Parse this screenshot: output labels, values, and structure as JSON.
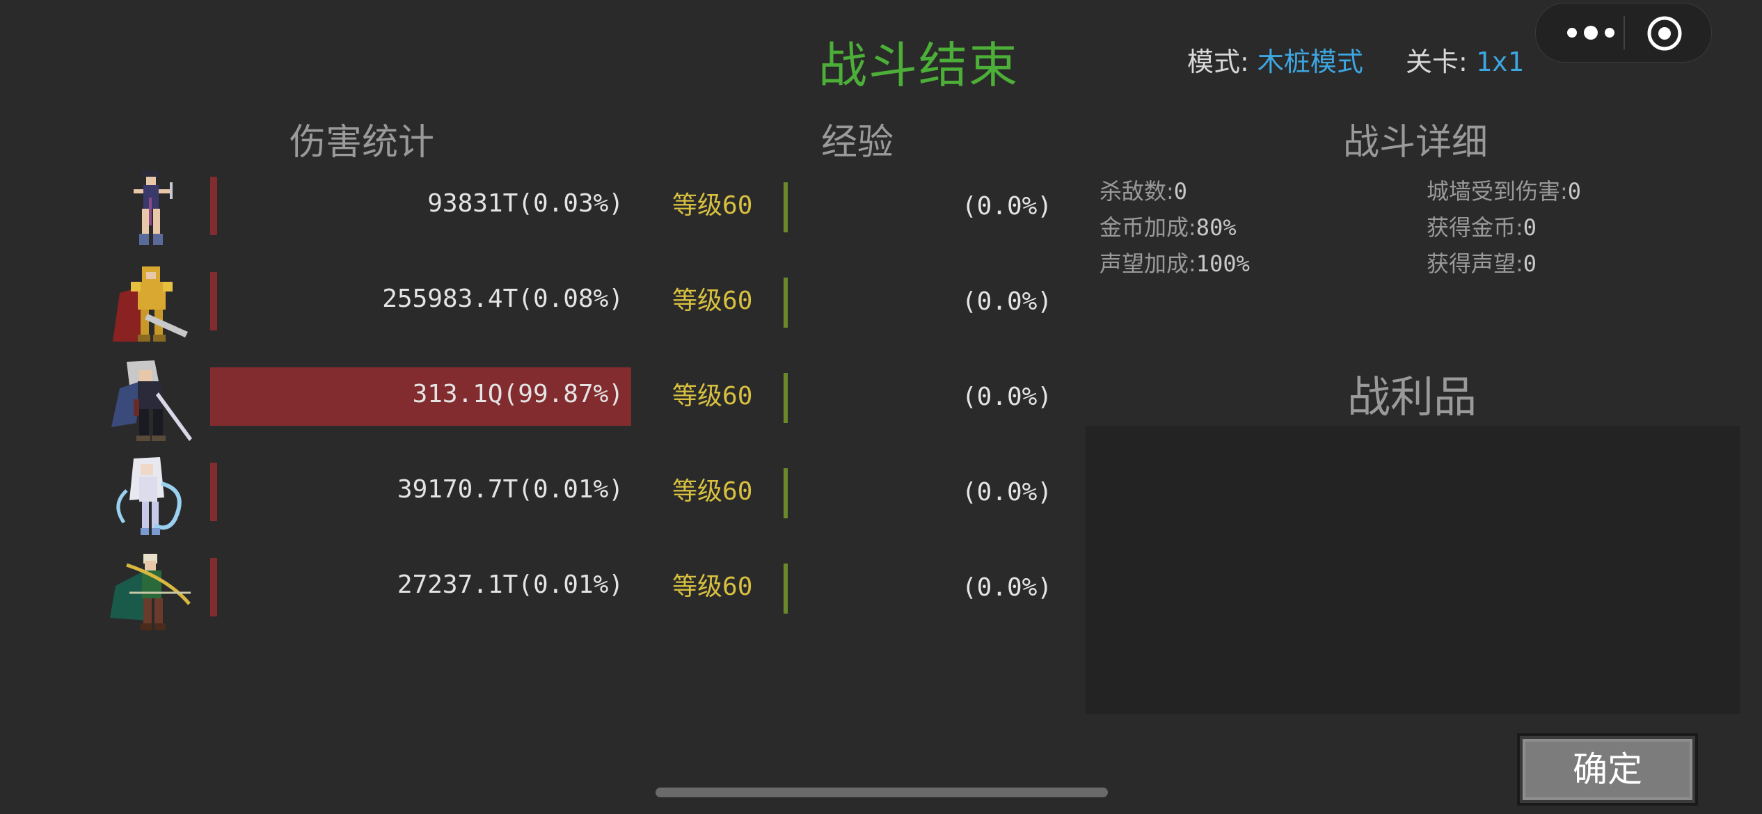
{
  "header": {
    "title": "战斗结束",
    "mode_label": "模式:",
    "mode_value": "木桩模式",
    "stage_label": "关卡:",
    "stage_value": "1x1"
  },
  "system_pill": {
    "more_icon": "more-dots-icon",
    "close_icon": "target-circle-icon"
  },
  "sections": {
    "damage": "伤害统计",
    "exp": "经验",
    "details": "战斗详细",
    "loot": "战利品"
  },
  "heroes": [
    {
      "avatar": "hero-assassin",
      "damage_text": "93831T(0.03%)",
      "damage_fraction": 0.0003,
      "level_label": "等级",
      "level_num": "60",
      "exp_text": "(0.0%)",
      "exp_fraction": 0.0
    },
    {
      "avatar": "hero-knight",
      "damage_text": "255983.4T(0.08%)",
      "damage_fraction": 0.0008,
      "level_label": "等级",
      "level_num": "60",
      "exp_text": "(0.0%)",
      "exp_fraction": 0.0
    },
    {
      "avatar": "hero-swordsman",
      "damage_text": "313.1Q(99.87%)",
      "damage_fraction": 0.9987,
      "level_label": "等级",
      "level_num": "60",
      "exp_text": "(0.0%)",
      "exp_fraction": 0.0
    },
    {
      "avatar": "hero-ice-mage",
      "damage_text": "39170.7T(0.01%)",
      "damage_fraction": 0.0001,
      "level_label": "等级",
      "level_num": "60",
      "exp_text": "(0.0%)",
      "exp_fraction": 0.0
    },
    {
      "avatar": "hero-archer",
      "damage_text": "27237.1T(0.01%)",
      "damage_fraction": 0.0001,
      "level_label": "等级",
      "level_num": "60",
      "exp_text": "(0.0%)",
      "exp_fraction": 0.0
    }
  ],
  "details": {
    "kills_label": "杀敌数:",
    "kills_value": "0",
    "wall_damage_label": "城墙受到伤害:",
    "wall_damage_value": "0",
    "gold_bonus_label": "金币加成:",
    "gold_bonus_value": "80%",
    "gold_gain_label": "获得金币:",
    "gold_gain_value": "0",
    "fame_bonus_label": "声望加成:",
    "fame_bonus_value": "100%",
    "fame_gain_label": "获得声望:",
    "fame_gain_value": "0"
  },
  "confirm_label": "确定",
  "colors": {
    "title": "#4caf38",
    "damage_bar": "#832c2f",
    "exp_bar": "#6a8a2a",
    "level_text": "#d8c040",
    "link_value": "#3ea6e0"
  }
}
